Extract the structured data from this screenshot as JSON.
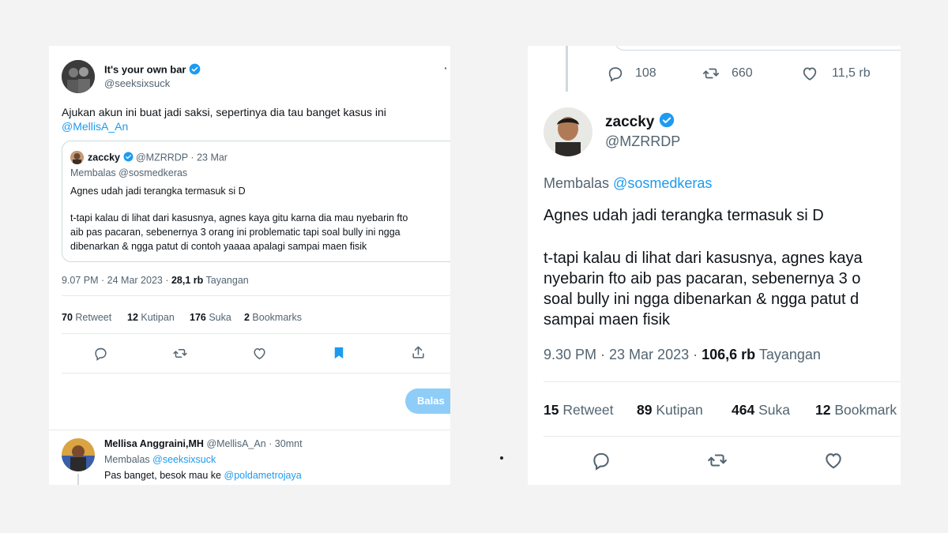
{
  "left": {
    "author": {
      "name": "It's your own bar",
      "handle": "@seeksixsuck"
    },
    "more_menu": "·",
    "tweet_text": "Ajukan akun ini buat jadi saksi, sepertinya dia tau banget kasus ini",
    "mention": "@MellisA_An",
    "quote": {
      "name": "zaccky",
      "handle": "@MZRRDP",
      "sep": "·",
      "date": "23 Mar",
      "replying_prefix": "Membalas",
      "replying_to": "@sosmedkeras",
      "line1": "Agnes udah jadi terangka termasuk si D",
      "line2": "t-tapi kalau di lihat dari kasusnya, agnes kaya gitu karna dia mau nyebarin fto",
      "line3": "aib pas pacaran, sebenernya 3 orang ini problematic tapi soal bully ini ngga",
      "line4": "dibenarkan & ngga patut di contoh yaaaa apalagi sampai maen fisik"
    },
    "meta": {
      "time": "9.07 PM · 24 Mar 2023 · ",
      "views": "28,1 rb",
      "views_label": " Tayangan"
    },
    "stats": {
      "retweets": "70",
      "retweets_label": " Retweet",
      "quotes": "12",
      "quotes_label": " Kutipan",
      "likes": "176",
      "likes_label": " Suka",
      "bookmarks": "2",
      "bookmarks_label": " Bookmarks"
    },
    "reply_button": "Balas",
    "reply_tweet": {
      "name": "Mellisa Anggraini,MH",
      "handle": "@MellisA_An",
      "sep": "·",
      "time": "30mnt",
      "replying_prefix": "Membalas",
      "replying_to": "@seeksixsuck",
      "text": "Pas banget, besok mau ke",
      "mention": "@poldametrojaya"
    }
  },
  "right": {
    "prev_stats": {
      "replies": "108",
      "retweets": "660",
      "likes": "11,5 rb"
    },
    "author": {
      "name": "zaccky",
      "handle": "@MZRRDP"
    },
    "replying_prefix": "Membalas",
    "replying_to": "@sosmedkeras",
    "line1": "Agnes udah jadi terangka termasuk si D",
    "line2": "t-tapi kalau di lihat dari kasusnya, agnes kaya",
    "line3": "nyebarin fto aib pas pacaran, sebenernya 3 o",
    "line4": "soal bully ini ngga dibenarkan & ngga patut d",
    "line5": "sampai maen fisik",
    "meta": {
      "time": "9.30 PM · 23 Mar 2023 · ",
      "views": "106,6 rb",
      "views_label": " Tayangan"
    },
    "stats": {
      "retweets": "15",
      "retweets_label": " Retweet",
      "quotes": "89",
      "quotes_label": " Kutipan",
      "likes": "464",
      "likes_label": " Suka",
      "bookmarks": "12",
      "bookmarks_label": " Bookmark"
    }
  },
  "colors": {
    "accent": "#1d9bf0",
    "bookmark_active": "#1d9bf0",
    "reply_button": "#8ecdf8",
    "text": "#0f1419",
    "muted": "#536471"
  },
  "icons": [
    "verified-badge-icon",
    "reply-icon",
    "retweet-icon",
    "like-icon",
    "bookmark-icon",
    "share-icon",
    "more-icon"
  ]
}
